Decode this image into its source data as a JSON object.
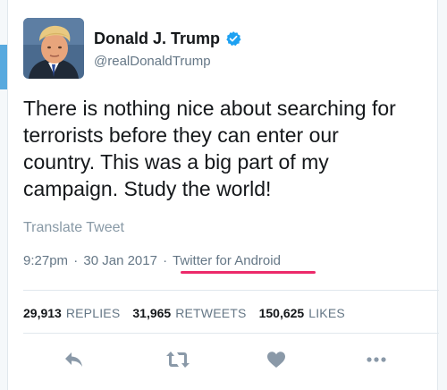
{
  "user": {
    "display_name": "Donald J. Trump",
    "handle": "@realDonaldTrump",
    "verified": true,
    "verified_icon": "verified-badge-icon"
  },
  "tweet": {
    "text": "There is nothing nice about searching for\nterrorists before they can enter our\ncountry. This was a big part of my\ncampaign. Study the world!",
    "translate_label": "Translate Tweet",
    "time": "9:27pm",
    "date": "30 Jan 2017",
    "separator": "·",
    "source": "Twitter for Android"
  },
  "stats": {
    "replies_count": "29,913",
    "replies_label": "REPLIES",
    "retweets_count": "31,965",
    "retweets_label": "RETWEETS",
    "likes_count": "150,625",
    "likes_label": "LIKES"
  },
  "actions": [
    {
      "name": "reply",
      "icon": "reply-icon"
    },
    {
      "name": "retweet",
      "icon": "retweet-icon"
    },
    {
      "name": "like",
      "icon": "heart-icon"
    },
    {
      "name": "more",
      "icon": "more-dots-icon"
    }
  ],
  "colors": {
    "text": "#14171a",
    "secondary": "#657786",
    "muted": "#8899a6",
    "verified": "#1da1f2",
    "highlight": "#ec2a6a",
    "accent_bar": "#58a9de",
    "divider": "#e1e8ed",
    "icon": "#8a99a8"
  }
}
